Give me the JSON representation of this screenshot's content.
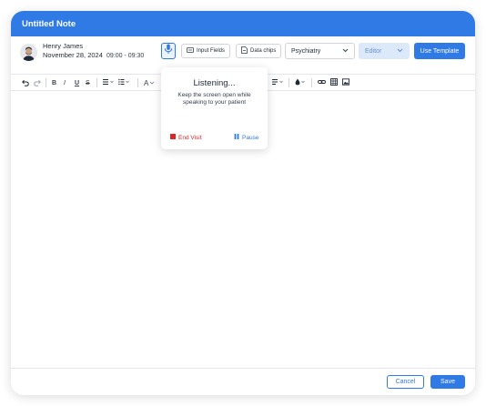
{
  "note": {
    "title": "Untitled Note"
  },
  "patient": {
    "name": "Henry James",
    "date": "November 28, 2024",
    "time": "09:00 - 09:30"
  },
  "header": {
    "input_fields_label": "Input Fields",
    "data_chips_label": "Data chips",
    "specialty_value": "Psychiatry",
    "mode_value": "Editor",
    "use_template_label": "Use Template"
  },
  "toolbar": {
    "undo_icon": "undo-icon",
    "redo_icon": "redo-icon",
    "bold": "B",
    "italic": "I",
    "underline": "U",
    "strike": "S",
    "font_glyph": "A",
    "icons": [
      "align-icon",
      "list-icon",
      "font-color-icon",
      "line-spacing-icon",
      "fill-icon",
      "link-icon",
      "table-icon",
      "image-icon"
    ]
  },
  "listening_popup": {
    "title": "Listening...",
    "message": "Keep the screen open while speaking to your patient",
    "end_visit_label": "End Visit",
    "pause_label": "Pause"
  },
  "footer": {
    "cancel_label": "Cancel",
    "save_label": "Save"
  },
  "colors": {
    "accent": "#2f7ae5",
    "danger": "#dc2626",
    "editor_select_bg": "#dbe9fb"
  }
}
